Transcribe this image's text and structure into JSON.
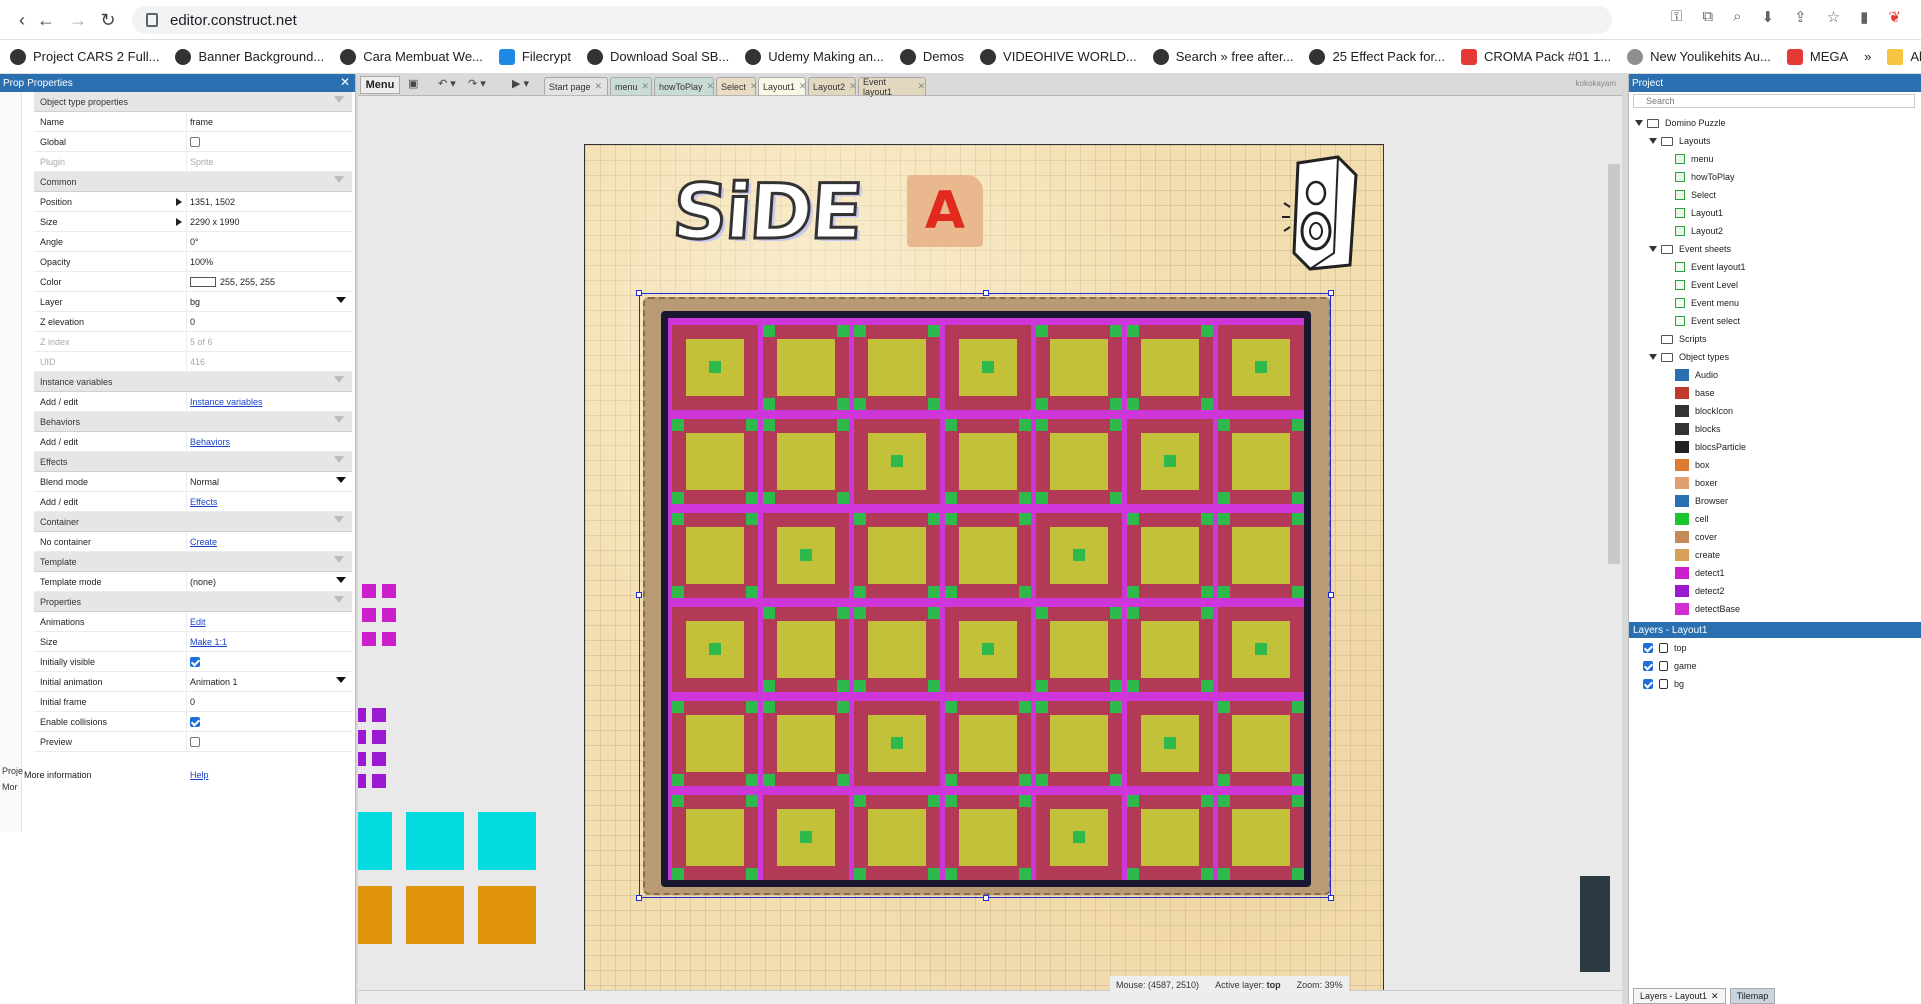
{
  "browser": {
    "url": "editor.construct.net",
    "bookmarks": [
      "Project CARS 2 Full...",
      "Banner Background...",
      "Cara Membuat We...",
      "Filecrypt",
      "Download Soal SB...",
      "Udemy Making an...",
      "Demos",
      "VIDEOHIVE WORLD...",
      "Search » free after...",
      "25 Effect Pack for...",
      "CROMA Pack #01 1...",
      "New Youlikehits Au...",
      "MEGA",
      "All Bookmarks"
    ]
  },
  "properties": {
    "header": "Properties",
    "header_prefix": "Prop",
    "sections": {
      "object_type": "Object type properties",
      "common": "Common",
      "instance_vars": "Instance variables",
      "behaviors": "Behaviors",
      "effects": "Effects",
      "container": "Container",
      "template": "Template",
      "props": "Properties"
    },
    "rows": {
      "name": {
        "k": "Name",
        "v": "frame"
      },
      "global": {
        "k": "Global"
      },
      "plugin": {
        "k": "Plugin",
        "v": "Sprite"
      },
      "position": {
        "k": "Position",
        "v": "1351, 1502"
      },
      "size": {
        "k": "Size",
        "v": "2290 x 1990"
      },
      "angle": {
        "k": "Angle",
        "v": "0°"
      },
      "opacity": {
        "k": "Opacity",
        "v": "100%"
      },
      "color": {
        "k": "Color",
        "v": "255, 255, 255"
      },
      "layer": {
        "k": "Layer",
        "v": "bg"
      },
      "z_elev": {
        "k": "Z elevation",
        "v": "0"
      },
      "z_index": {
        "k": "Z index",
        "v": "5 of 6"
      },
      "uid": {
        "k": "UID",
        "v": "416"
      },
      "add_edit_iv": {
        "k": "Add / edit",
        "v": "Instance variables"
      },
      "add_edit_beh": {
        "k": "Add / edit",
        "v": "Behaviors"
      },
      "blend": {
        "k": "Blend mode",
        "v": "Normal"
      },
      "add_edit_eff": {
        "k": "Add / edit",
        "v": "Effects"
      },
      "no_container": {
        "k": "No container",
        "v": "Create"
      },
      "template_mode": {
        "k": "Template mode",
        "v": "(none)"
      },
      "animations": {
        "k": "Animations",
        "v": "Edit"
      },
      "size2": {
        "k": "Size",
        "v": "Make 1:1"
      },
      "init_visible": {
        "k": "Initially visible"
      },
      "init_anim": {
        "k": "Initial animation",
        "v": "Animation 1"
      },
      "init_frame": {
        "k": "Initial frame",
        "v": "0"
      },
      "collisions": {
        "k": "Enable collisions"
      },
      "preview": {
        "k": "Preview"
      }
    },
    "more_info": {
      "k": "More information",
      "v": "Help"
    },
    "strip_labels": [
      "Proje",
      "Mor"
    ]
  },
  "editor": {
    "menu_label": "Menu",
    "tabs": [
      "Start page",
      "menu",
      "howToPlay",
      "Select",
      "Layout1",
      "Layout2",
      "Event layout1"
    ],
    "active_tab": "Layout1",
    "user": "kokokayam",
    "canvas_title": "SiDE",
    "canvas_letter": "A",
    "status": {
      "mouse": "Mouse: (4587, 2510)",
      "active_layer_label": "Active layer:",
      "active_layer": "top",
      "zoom": "Zoom: 39%"
    },
    "colors": {
      "board_bg": "#cf36d9",
      "cell_border": "#b33a56",
      "cell_fill": "#c3c03a",
      "dot": "#2dba4a",
      "cyan": "#04dbe0",
      "orange": "#e0940c",
      "magenta": "#cc1ecb",
      "purple": "#9a19d1"
    }
  },
  "project": {
    "header": "Project",
    "search_placeholder": "Search",
    "root": "Domino Puzzle",
    "layouts_label": "Layouts",
    "layouts": [
      "menu",
      "howToPlay",
      "Select",
      "Layout1",
      "Layout2"
    ],
    "events_label": "Event sheets",
    "events": [
      "Event layout1",
      "Event Level",
      "Event menu",
      "Event select"
    ],
    "scripts_label": "Scripts",
    "objects_label": "Object types",
    "objects": [
      {
        "name": "Audio",
        "color": "#2a6fb0"
      },
      {
        "name": "base",
        "color": "#c0392b"
      },
      {
        "name": "blockIcon",
        "color": "#333333"
      },
      {
        "name": "blocks",
        "color": "#333333"
      },
      {
        "name": "blocsParticle",
        "color": "#222222"
      },
      {
        "name": "box",
        "color": "#e07a30"
      },
      {
        "name": "boxer",
        "color": "#e0a070"
      },
      {
        "name": "Browser",
        "color": "#2a6fb0"
      },
      {
        "name": "cell",
        "color": "#19c62f"
      },
      {
        "name": "cover",
        "color": "#c48a5a"
      },
      {
        "name": "create",
        "color": "#d6a05a"
      },
      {
        "name": "detect1",
        "color": "#cc1ecb"
      },
      {
        "name": "detect2",
        "color": "#9a19d1"
      },
      {
        "name": "detectBase",
        "color": "#d42bd6"
      }
    ]
  },
  "layers": {
    "header": "Layers - Layout1",
    "items": [
      "top",
      "game",
      "bg"
    ]
  },
  "bottom_tabs": [
    "Layers - Layout1",
    "Tilemap"
  ]
}
